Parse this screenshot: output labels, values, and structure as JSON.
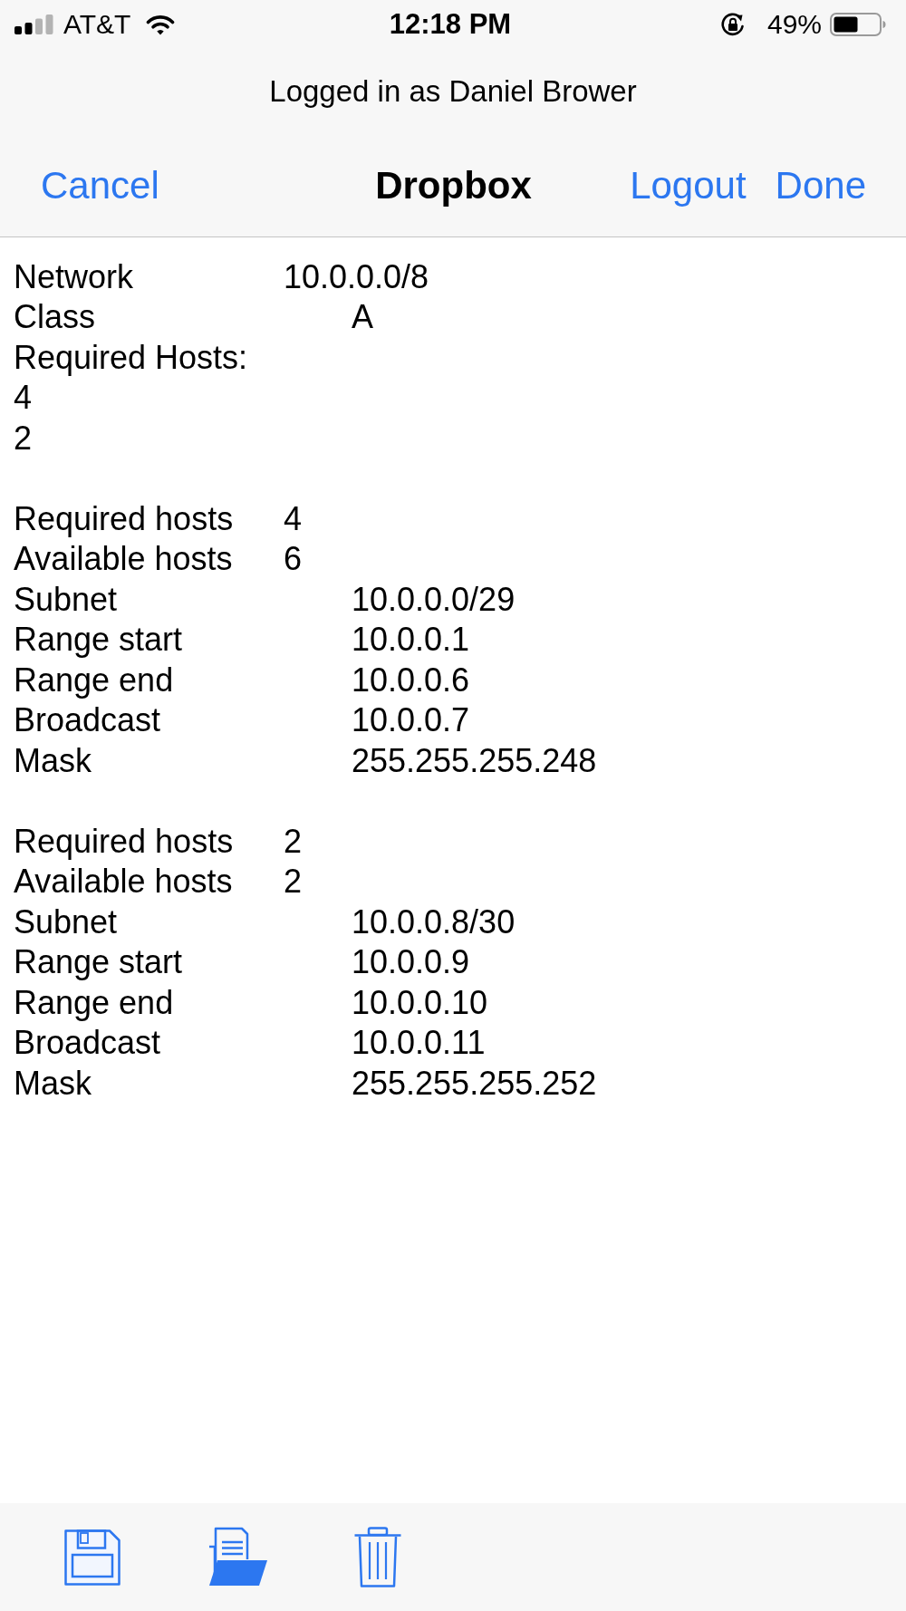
{
  "status_bar": {
    "carrier": "AT&T",
    "time": "12:18 PM",
    "battery": "49%"
  },
  "navigation": {
    "subtitle": "Logged in as Daniel Brower",
    "title": "Dropbox",
    "left_button": "Cancel",
    "right_buttons": [
      "Logout",
      "Done"
    ]
  },
  "document": {
    "sections": [
      {
        "lines": [
          {
            "kind": "near",
            "label": "Network",
            "value": "10.0.0.0/8"
          },
          {
            "kind": "far",
            "label": "Class",
            "value": "A"
          },
          {
            "kind": "single",
            "text": "Required Hosts:"
          },
          {
            "kind": "single",
            "text": "4"
          },
          {
            "kind": "single",
            "text": "2"
          }
        ]
      },
      {
        "lines": [
          {
            "kind": "near",
            "label": "Required hosts",
            "value": "4"
          },
          {
            "kind": "near",
            "label": "Available hosts",
            "value": "6"
          },
          {
            "kind": "far",
            "label": "Subnet",
            "value": "10.0.0.0/29"
          },
          {
            "kind": "far",
            "label": "Range start",
            "value": "10.0.0.1"
          },
          {
            "kind": "far",
            "label": "Range end",
            "value": "10.0.0.6"
          },
          {
            "kind": "far",
            "label": "Broadcast",
            "value": "10.0.0.7"
          },
          {
            "kind": "far",
            "label": "Mask",
            "value": "255.255.255.248"
          }
        ]
      },
      {
        "lines": [
          {
            "kind": "near",
            "label": "Required hosts",
            "value": "2"
          },
          {
            "kind": "near",
            "label": "Available hosts",
            "value": "2"
          },
          {
            "kind": "far",
            "label": "Subnet",
            "value": "10.0.0.8/30"
          },
          {
            "kind": "far",
            "label": "Range start",
            "value": "10.0.0.9"
          },
          {
            "kind": "far",
            "label": "Range end",
            "value": "10.0.0.10"
          },
          {
            "kind": "far",
            "label": "Broadcast",
            "value": "10.0.0.11"
          },
          {
            "kind": "far",
            "label": "Mask",
            "value": "255.255.255.252"
          }
        ]
      }
    ]
  },
  "toolbar": {
    "buttons": [
      {
        "kind": "save"
      },
      {
        "kind": "open"
      },
      {
        "kind": "delete"
      }
    ]
  }
}
